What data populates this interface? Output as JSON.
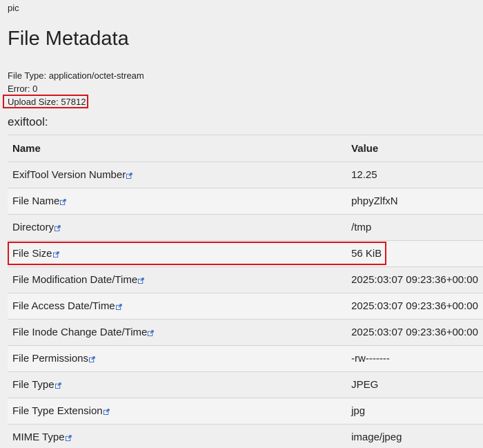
{
  "header": {
    "top_label": "pic",
    "title": "File Metadata"
  },
  "meta": {
    "file_type": "File Type: application/octet-stream",
    "error": "Error: 0",
    "upload_size": "Upload Size: 57812"
  },
  "exiftool": {
    "section_title": "exiftool:",
    "columns": {
      "name": "Name",
      "value": "Value"
    },
    "rows": [
      {
        "name": "ExifTool Version Number",
        "value": "12.25"
      },
      {
        "name": "File Name",
        "value": "phpyZlfxN"
      },
      {
        "name": "Directory",
        "value": "/tmp"
      },
      {
        "name": "File Size",
        "value": "56 KiB"
      },
      {
        "name": "File Modification Date/Time",
        "value": "2025:03:07 09:23:36+00:00"
      },
      {
        "name": "File Access Date/Time",
        "value": "2025:03:07 09:23:36+00:00"
      },
      {
        "name": "File Inode Change Date/Time",
        "value": "2025:03:07 09:23:36+00:00"
      },
      {
        "name": "File Permissions",
        "value": "-rw-------"
      },
      {
        "name": "File Type",
        "value": "JPEG"
      },
      {
        "name": "File Type Extension",
        "value": "jpg"
      },
      {
        "name": "MIME Type",
        "value": "image/jpeg"
      }
    ]
  },
  "colors": {
    "highlight": "#d9131b",
    "link_icon": "#2b5fb8",
    "background": "#efefef"
  },
  "icons": {
    "row_link": "external-link-icon"
  }
}
